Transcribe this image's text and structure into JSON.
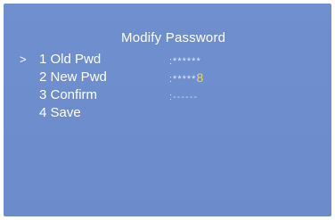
{
  "screen": {
    "title": "Modify Password",
    "cursor": ">",
    "items": [
      {
        "label": "1  Old Pwd",
        "value_prefix": ":******",
        "value_highlight": ""
      },
      {
        "label": "2  New Pwd",
        "value_prefix": ":*****",
        "value_highlight": "8"
      },
      {
        "label": "3  Confirm",
        "value_prefix": ":------",
        "value_highlight": ""
      },
      {
        "label": "4  Save",
        "value_prefix": "",
        "value_highlight": ""
      }
    ]
  },
  "colors": {
    "background": "#6F8FCF",
    "text": "#FFFFFF",
    "highlight": "#E9D36B"
  }
}
